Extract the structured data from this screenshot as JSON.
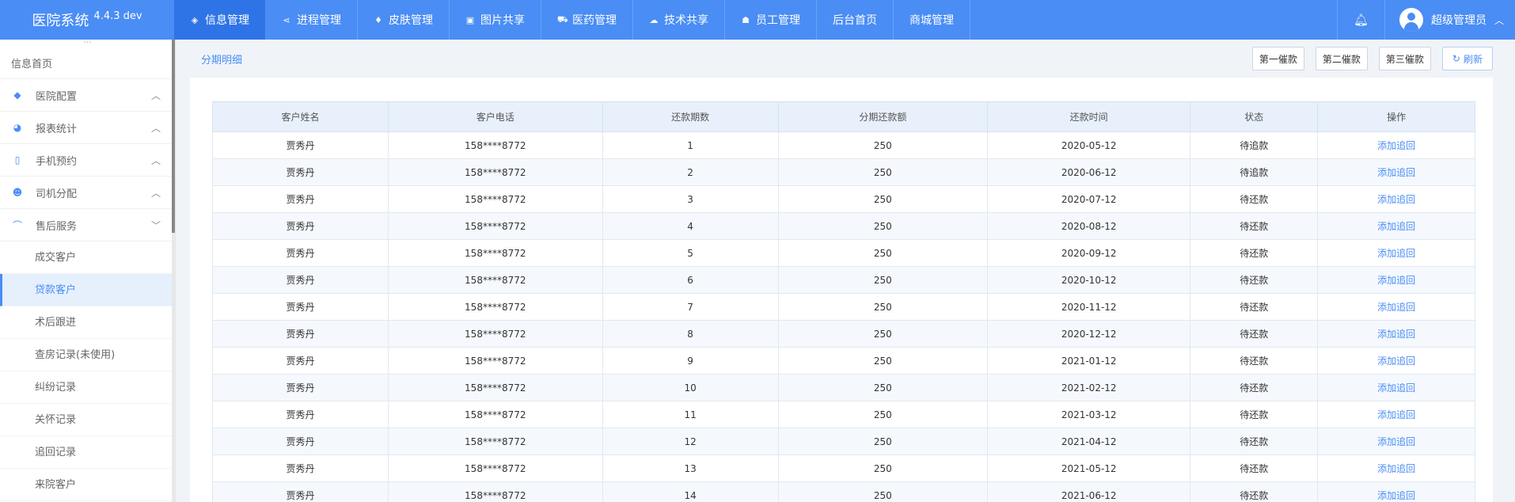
{
  "app": {
    "title": "医院系统",
    "version": "4.4.3 dev"
  },
  "nav": [
    {
      "label": "信息管理",
      "icon": "cube-icon",
      "glyph": "◈"
    },
    {
      "label": "进程管理",
      "icon": "share-icon",
      "glyph": "⋖"
    },
    {
      "label": "皮肤管理",
      "icon": "diamond-icon",
      "glyph": "♦"
    },
    {
      "label": "图片共享",
      "icon": "image-icon",
      "glyph": "▣"
    },
    {
      "label": "医药管理",
      "icon": "cart-icon",
      "glyph": "⛟"
    },
    {
      "label": "技术共享",
      "icon": "cloud-icon",
      "glyph": "☁"
    },
    {
      "label": "员工管理",
      "icon": "users-icon",
      "glyph": "☗"
    },
    {
      "label": "后台首页",
      "icon": "",
      "glyph": ""
    },
    {
      "label": "商城管理",
      "icon": "",
      "glyph": ""
    }
  ],
  "user": {
    "name": "超级管理员"
  },
  "sidebar": {
    "home": "信息首页",
    "groups": [
      {
        "label": "医院配置",
        "icon": "layers-icon",
        "glyph": "◆",
        "expanded": false
      },
      {
        "label": "报表统计",
        "icon": "pie-chart-icon",
        "glyph": "◕",
        "expanded": false
      },
      {
        "label": "手机预约",
        "icon": "phone-icon",
        "glyph": "▯",
        "expanded": false
      },
      {
        "label": "司机分配",
        "icon": "person-icon",
        "glyph": "☻",
        "expanded": false
      },
      {
        "label": "售后服务",
        "icon": "headset-icon",
        "glyph": "⌒",
        "expanded": true
      }
    ],
    "subitems": [
      "成交客户",
      "贷款客户",
      "术后跟进",
      "查房记录(未使用)",
      "纠纷记录",
      "关怀记录",
      "追回记录",
      "来院客户"
    ],
    "active_sub": "贷款客户"
  },
  "page": {
    "breadcrumb": "分期明细",
    "buttons": [
      "第一催款",
      "第二催款",
      "第三催款"
    ],
    "refresh_label": "刷新"
  },
  "table": {
    "columns": [
      "客户姓名",
      "客户电话",
      "还款期数",
      "分期还款额",
      "还款时间",
      "状态",
      "操作"
    ],
    "rows": [
      [
        "贾秀丹",
        "158****8772",
        "1",
        "250",
        "2020-05-12",
        "待追款",
        "添加追回"
      ],
      [
        "贾秀丹",
        "158****8772",
        "2",
        "250",
        "2020-06-12",
        "待追款",
        "添加追回"
      ],
      [
        "贾秀丹",
        "158****8772",
        "3",
        "250",
        "2020-07-12",
        "待还款",
        "添加追回"
      ],
      [
        "贾秀丹",
        "158****8772",
        "4",
        "250",
        "2020-08-12",
        "待还款",
        "添加追回"
      ],
      [
        "贾秀丹",
        "158****8772",
        "5",
        "250",
        "2020-09-12",
        "待还款",
        "添加追回"
      ],
      [
        "贾秀丹",
        "158****8772",
        "6",
        "250",
        "2020-10-12",
        "待还款",
        "添加追回"
      ],
      [
        "贾秀丹",
        "158****8772",
        "7",
        "250",
        "2020-11-12",
        "待还款",
        "添加追回"
      ],
      [
        "贾秀丹",
        "158****8772",
        "8",
        "250",
        "2020-12-12",
        "待还款",
        "添加追回"
      ],
      [
        "贾秀丹",
        "158****8772",
        "9",
        "250",
        "2021-01-12",
        "待还款",
        "添加追回"
      ],
      [
        "贾秀丹",
        "158****8772",
        "10",
        "250",
        "2021-02-12",
        "待还款",
        "添加追回"
      ],
      [
        "贾秀丹",
        "158****8772",
        "11",
        "250",
        "2021-03-12",
        "待还款",
        "添加追回"
      ],
      [
        "贾秀丹",
        "158****8772",
        "12",
        "250",
        "2021-04-12",
        "待还款",
        "添加追回"
      ],
      [
        "贾秀丹",
        "158****8772",
        "13",
        "250",
        "2021-05-12",
        "待还款",
        "添加追回"
      ],
      [
        "贾秀丹",
        "158****8772",
        "14",
        "250",
        "2021-06-12",
        "待还款",
        "添加追回"
      ]
    ]
  },
  "colors": {
    "primary": "#4a8df5",
    "active_nav": "#2f74e6",
    "header_bg": "#e8f0fb"
  }
}
